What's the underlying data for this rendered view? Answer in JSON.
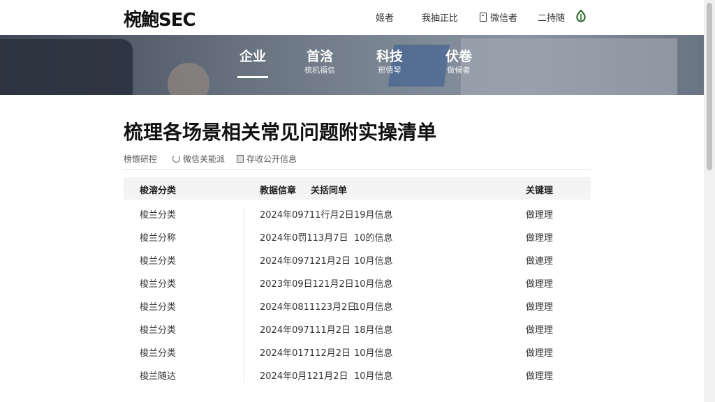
{
  "header": {
    "logo": "椀鮑SEC",
    "nav": [
      {
        "label": "姬者"
      },
      {
        "label": "我抽正比"
      },
      {
        "label": "微信者"
      },
      {
        "label": "二持随"
      }
    ]
  },
  "banner": {
    "tabs": [
      {
        "title": "企业",
        "subtitle": ""
      },
      {
        "title": "首浛",
        "subtitle": "梳机福信"
      },
      {
        "title": "科技",
        "subtitle": "邢情琴"
      },
      {
        "title": "伏卷",
        "subtitle": "做候者"
      }
    ]
  },
  "article": {
    "title": "梳理各场景相关常见问题附实操清单",
    "meta": [
      {
        "label": "榜懷研控"
      },
      {
        "label": "微信关能派"
      },
      {
        "label": "存收公开信息"
      }
    ]
  },
  "table": {
    "headers": [
      "梭溶分类",
      "教据信章",
      "关括同单",
      "关键理"
    ],
    "rows": [
      {
        "category": "梭兰分类",
        "date": "2024年09711行月2日",
        "info": "19月信息",
        "action": "做理理"
      },
      {
        "category": "梭兰分称",
        "date": "2024年0罚113月7日",
        "info": "10的信息",
        "action": "做理理"
      },
      {
        "category": "梭兰分类",
        "date": "2024年097121月2日",
        "info": "10月信息",
        "action": "做連理"
      },
      {
        "category": "梭兰分类",
        "date": "2023年09日121月2日",
        "info": "10月信息",
        "action": "做理理"
      },
      {
        "category": "梭兰分类",
        "date": "2024年0811123月2日",
        "info": "10月信息",
        "action": "做理理"
      },
      {
        "category": "梭兰分类",
        "date": "2024年097111月2日",
        "info": "18月信息",
        "action": "做理理"
      },
      {
        "category": "梭兰分类",
        "date": "2024年017112月2日",
        "info": "10月信息",
        "action": "做理理"
      },
      {
        "category": "梭兰随达",
        "date": "2024年0月121月2日",
        "info": "10月信息",
        "action": "做理理"
      }
    ]
  }
}
